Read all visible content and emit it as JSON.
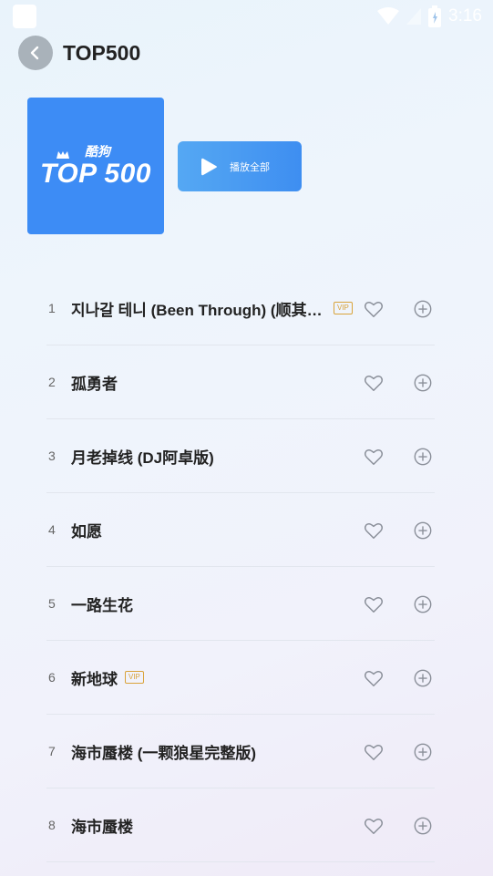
{
  "status_bar": {
    "time": "3:16",
    "icons": [
      "wifi-icon",
      "signal-icon",
      "battery-icon"
    ]
  },
  "header": {
    "back_icon": "chevron-left-icon",
    "title": "TOP500"
  },
  "cover": {
    "brand": "酷狗",
    "label": "TOP 500",
    "color": "#3d8cf5"
  },
  "play_all": {
    "icon": "play-icon",
    "label": "播放全部"
  },
  "songs": [
    {
      "num": "1",
      "title": "지나갈 테니 (Been Through) (顺其自然)",
      "vip": "VIP"
    },
    {
      "num": "2",
      "title": "孤勇者",
      "vip": ""
    },
    {
      "num": "3",
      "title": "月老掉线 (DJ阿卓版)",
      "vip": ""
    },
    {
      "num": "4",
      "title": "如愿",
      "vip": ""
    },
    {
      "num": "5",
      "title": "一路生花",
      "vip": ""
    },
    {
      "num": "6",
      "title": "新地球",
      "vip": "VIP"
    },
    {
      "num": "7",
      "title": "海市蜃楼 (一颗狼星完整版)",
      "vip": ""
    },
    {
      "num": "8",
      "title": "海市蜃楼",
      "vip": ""
    }
  ],
  "row_icons": {
    "like": "heart-icon",
    "add": "plus-circle-icon"
  },
  "colors": {
    "accent": "#3e8ef1",
    "vip": "#d9a33a"
  }
}
